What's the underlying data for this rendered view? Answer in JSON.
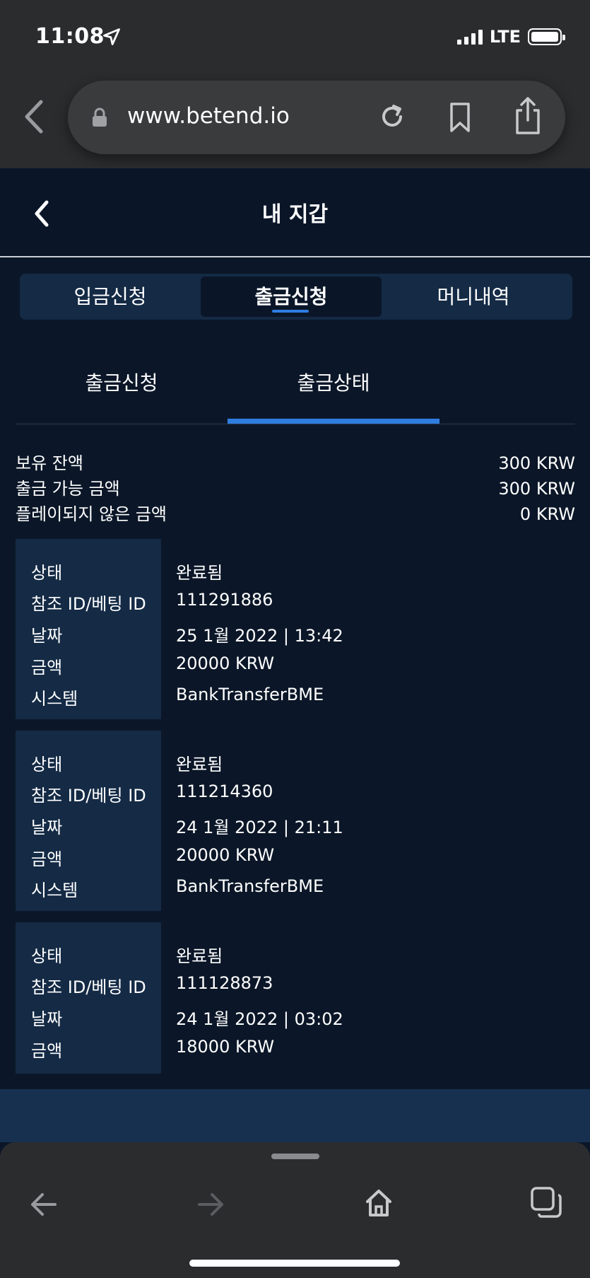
{
  "status_bar": {
    "time": "11:08",
    "network": "LTE",
    "location_icon": "location-arrow-icon",
    "signal_icon": "signal-bars-icon",
    "battery_icon": "battery-icon"
  },
  "browser": {
    "url": "www.betend.io",
    "icons": [
      "back-chevron-icon",
      "lock-icon",
      "reload-icon",
      "bookmark-icon",
      "share-icon"
    ]
  },
  "header": {
    "title": "내 지갑",
    "back_icon": "chevron-left-icon"
  },
  "main_tabs": [
    {
      "label": "입금신청",
      "active": false
    },
    {
      "label": "출금신청",
      "active": true
    },
    {
      "label": "머니내역",
      "active": false
    }
  ],
  "sub_tabs": [
    {
      "label": "출금신청",
      "active": false
    },
    {
      "label": "출금상태",
      "active": true
    }
  ],
  "balance": [
    {
      "label": "보유 잔액",
      "value": "300 KRW"
    },
    {
      "label": "출금 가능 금액",
      "value": "300 KRW"
    },
    {
      "label": "플레이되지 않은 금액",
      "value": "0 KRW"
    }
  ],
  "tx_labels": {
    "status": "상태",
    "ref": "참조 ID/베팅 ID",
    "date": "날짜",
    "amount": "금액",
    "system": "시스템"
  },
  "transactions": [
    {
      "status": "완료됨",
      "ref": "111291886",
      "date": "25 1월 2022 | 13:42",
      "amount": "20000 KRW",
      "system": "BankTransferBME"
    },
    {
      "status": "완료됨",
      "ref": "111214360",
      "date": "24 1월 2022 | 21:11",
      "amount": "20000 KRW",
      "system": "BankTransferBME"
    },
    {
      "status": "완료됨",
      "ref": "111128873",
      "date": "24 1월 2022 | 03:02",
      "amount": "18000 KRW",
      "system": ""
    }
  ],
  "toolbar": {
    "icons": [
      "arrow-left-icon",
      "arrow-right-icon",
      "home-icon",
      "tabs-icon"
    ]
  },
  "colors": {
    "page_bg": "#0b1728",
    "panel": "#142a45",
    "accent": "#2f7de1",
    "chrome": "#2b2c2e"
  }
}
